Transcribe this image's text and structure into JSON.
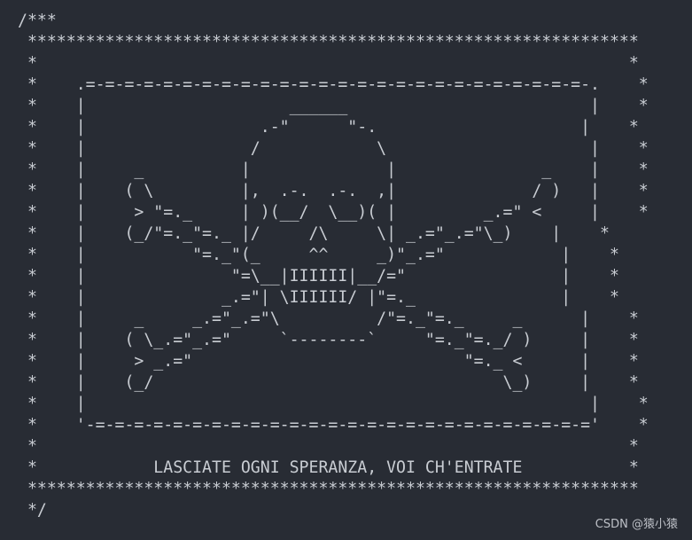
{
  "editor": {
    "lines": [
      "/***",
      " ***************************************************************",
      " *                                                             *",
      " *    .=-=-=-=-=-=-=-=-=-=-=-=-=-=-=-=-=-=-=-=-=-=-=-=-=-=-.    *",
      " *    |                     ______                         |    *",
      " *    |                  .-\"      \"-.                     |    *",
      " *    |                 /            \\                     |    *",
      " *    |     _          |              |               _    |    *",
      " *    |    ( \\         |,  .-.  .-.  ,|              / )   |    *",
      " *    |     > \"=._     | )(__/  \\__)( |         _.=\" <     |    *",
      " *    |    (_/\"=._\"=._ |/     /\\     \\| _.=\"_.=\"\\_)    |    *",
      " *    |           \"=._\"(_     ^^     _)\"_.=\"            |    *",
      " *    |               \"=\\__|IIIIII|__/=\"                |    *",
      " *    |              _.=\"| \\IIIIII/ |\"=._               |    *",
      " *    |     _     _.=\"_.=\"\\          /\"=._\"=._     _      |    *",
      " *    |    ( \\_.=\"_.=\"     `--------`     \"=._\"=._/ )     |    *",
      " *    |     > _.=\"                            \"=._ <      |    *",
      " *    |    (_/                                    \\_)     |    *",
      " *    |                                                    |    *",
      " *    '-=-=-=-=-=-=-=-=-=-=-=-=-=-=-=-=-=-=-=-=-=-=-=-=-=-='    *",
      " *                                                             *",
      " *            LASCIATE OGNI SPERANZA, VOI CH'ENTRATE           *",
      " ***************************************************************",
      " */"
    ]
  },
  "watermark": {
    "text": "CSDN @猿小猿"
  }
}
